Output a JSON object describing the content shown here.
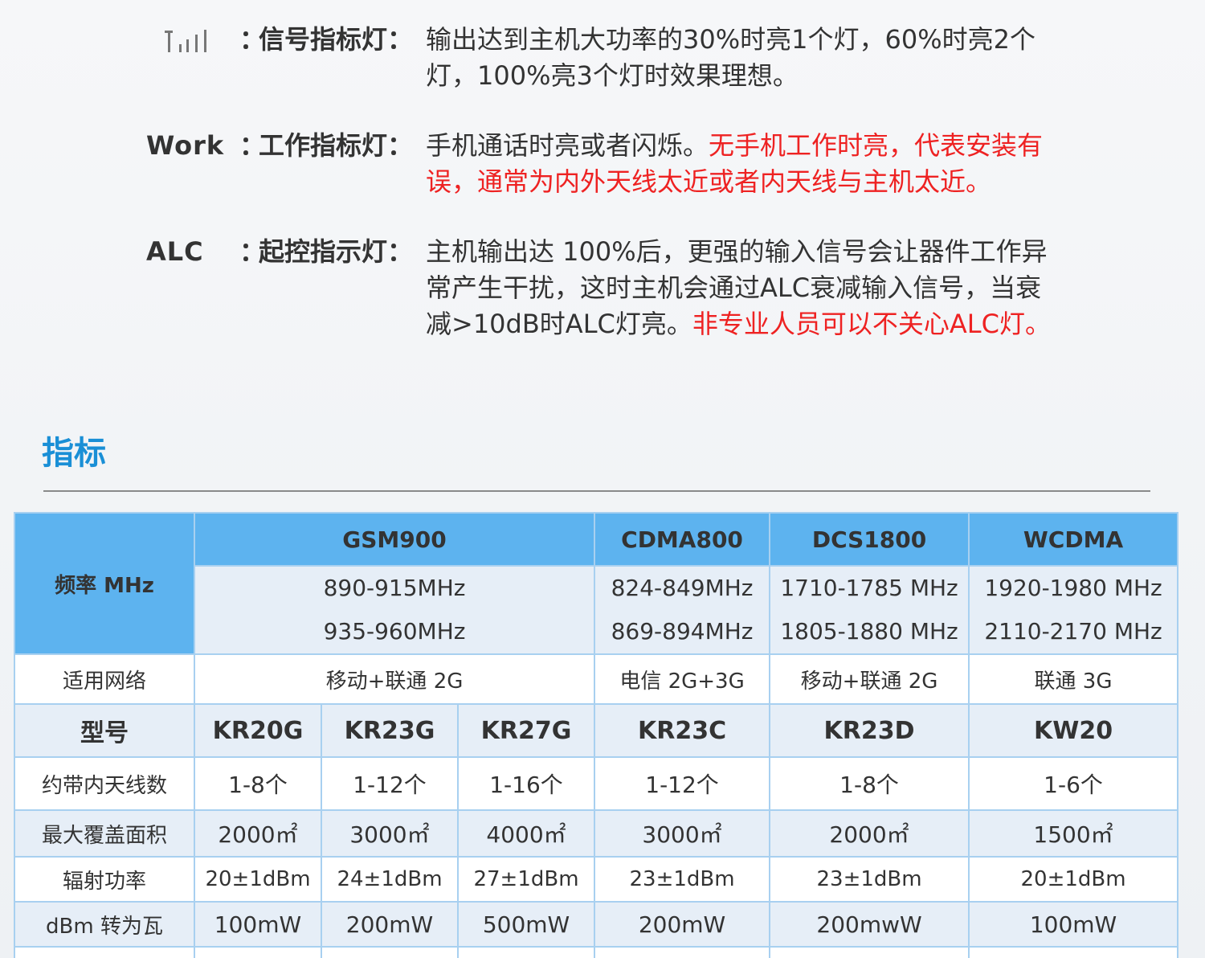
{
  "indicators": [
    {
      "label": "",
      "icon": "signal-bars-icon",
      "separator": "：",
      "name": "信号指标灯：",
      "lines": [
        [
          {
            "text": "输出达到主机大功率的30%时亮1个灯，60%时亮2个",
            "red": false
          }
        ],
        [
          {
            "text": "灯，100%亮3个灯时效果理想。",
            "red": false
          }
        ]
      ]
    },
    {
      "label": "Work",
      "separator": "：",
      "name": "工作指标灯：",
      "lines": [
        [
          {
            "text": "手机通话时亮或者闪烁。",
            "red": false
          },
          {
            "text": "无手机工作时亮，代表安装有",
            "red": true
          }
        ],
        [
          {
            "text": "误，通常为内外天线太近或者内天线与主机太近。",
            "red": true
          }
        ]
      ]
    },
    {
      "label": "ALC",
      "separator": "：",
      "name": "起控指示灯：",
      "lines": [
        [
          {
            "text": "主机输出达 100%后，更强的输入信号会让器件工作异",
            "red": false
          }
        ],
        [
          {
            "text": "常产生干扰，这时主机会通过ALC衰减输入信号，当衰",
            "red": false
          }
        ],
        [
          {
            "text": "减>10dB时ALC灯亮。",
            "red": false
          },
          {
            "text": "非专业人员可以不关心ALC灯。",
            "red": true
          }
        ]
      ]
    }
  ],
  "section": {
    "title": "指标"
  },
  "table": {
    "freq_label": "频率 MHz",
    "bands": [
      {
        "name": "GSM900",
        "uplink": "890-915MHz",
        "downlink": "935-960MHz"
      },
      {
        "name": "CDMA800",
        "uplink": "824-849MHz",
        "downlink": "869-894MHz"
      },
      {
        "name": "DCS1800",
        "uplink": "1710-1785 MHz",
        "downlink": "1805-1880 MHz"
      },
      {
        "name": "WCDMA",
        "uplink": "1920-1980 MHz",
        "downlink": "2110-2170 MHz"
      }
    ],
    "network_row": {
      "label": "适用网络",
      "values": [
        "移动+联通 2G",
        "电信 2G+3G",
        "移动+联通 2G",
        "联通 3G"
      ]
    },
    "model_row": {
      "label": "型号",
      "values": [
        "KR20G",
        "KR23G",
        "KR27G",
        "KR23C",
        "KR23D",
        "KW20"
      ]
    },
    "antenna_row": {
      "label": "约带内天线数",
      "values": [
        "1-8个",
        "1-12个",
        "1-16个",
        "1-12个",
        "1-8个",
        "1-6个"
      ]
    },
    "coverage_row": {
      "label": "最大覆盖面积",
      "values": [
        "2000㎡",
        "3000㎡",
        "4000㎡",
        "3000㎡",
        "2000㎡",
        "1500㎡"
      ]
    },
    "power_row": {
      "label": "辐射功率",
      "values": [
        "20±1dBm",
        "24±1dBm",
        "27±1dBm",
        "23±1dBm",
        "23±1dBm",
        "20±1dBm"
      ]
    },
    "watt_row": {
      "label": "dBm 转为瓦",
      "values": [
        "100mW",
        "200mW",
        "500mW",
        "200mW",
        "200mwW",
        "100mW"
      ]
    }
  }
}
